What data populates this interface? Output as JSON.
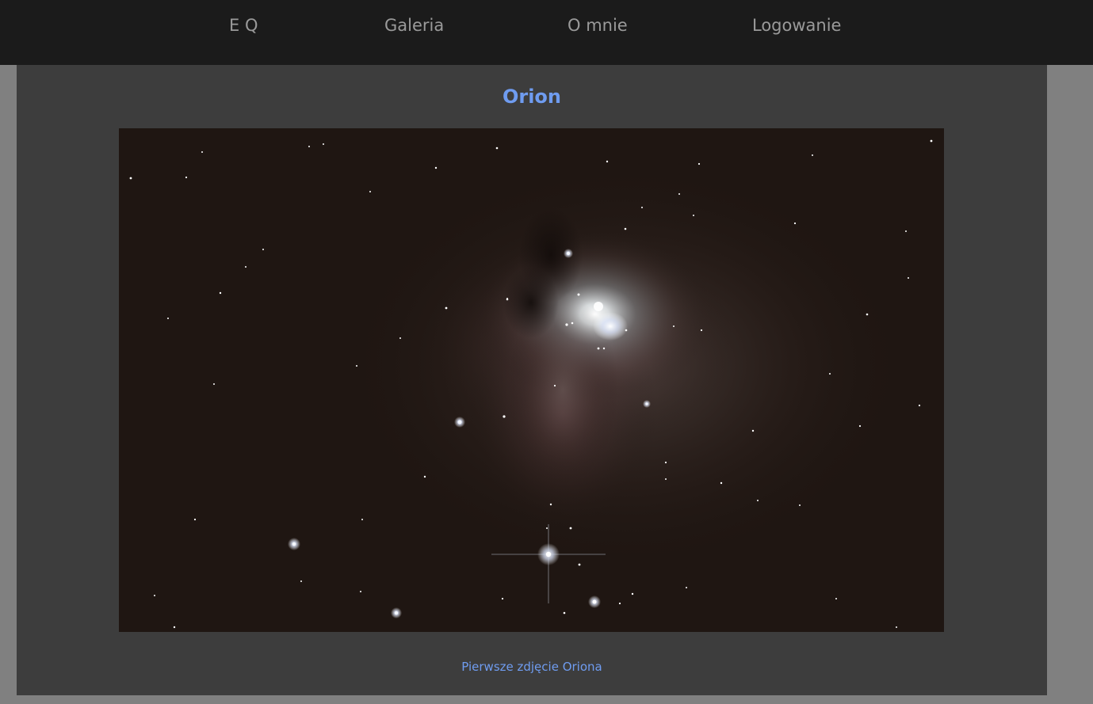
{
  "nav": {
    "items": [
      {
        "label": "E Q"
      },
      {
        "label": "Galeria"
      },
      {
        "label": "O mnie"
      },
      {
        "label": "Logowanie"
      }
    ]
  },
  "main": {
    "title": "Orion",
    "caption": "Pierwsze zdjęcie Oriona"
  },
  "colors": {
    "nav_bg": "#1b1b1b",
    "page_bg": "#808080",
    "panel_bg": "#3d3d3d",
    "accent": "#6f9cf0",
    "nav_text": "#9a9a9a"
  }
}
